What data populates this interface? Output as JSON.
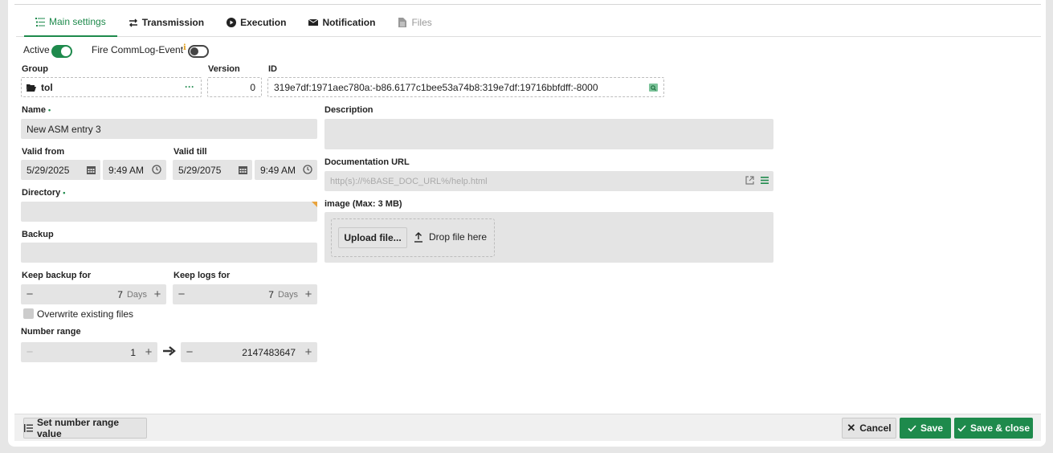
{
  "tabs": [
    {
      "label": "Main settings",
      "icon": "list-icon"
    },
    {
      "label": "Transmission",
      "icon": "arrows-swap-icon"
    },
    {
      "label": "Execution",
      "icon": "play-circle-icon"
    },
    {
      "label": "Notification",
      "icon": "envelope-icon"
    },
    {
      "label": "Files",
      "icon": "file-icon"
    }
  ],
  "active_tab": "Main settings",
  "toggles": {
    "active_label": "Active",
    "active_on": true,
    "fire_label": "Fire CommLog-Event",
    "fire_on": false
  },
  "group": {
    "label": "Group",
    "value": "tol",
    "more": "···"
  },
  "version": {
    "label": "Version",
    "value": "0"
  },
  "id": {
    "label": "ID",
    "value": "319e7df:1971aec780a:-b86.6177c1bee53a74b8:319e7df:19716bbfdff:-8000"
  },
  "name": {
    "label": "Name",
    "value": "New ASM entry 3",
    "required": "•"
  },
  "valid_from": {
    "label": "Valid from",
    "date": "5/29/2025",
    "time": "9:49 AM"
  },
  "valid_till": {
    "label": "Valid till",
    "date": "5/29/2075",
    "time": "9:49 AM"
  },
  "directory": {
    "label": "Directory",
    "value": "",
    "required": "•"
  },
  "backup": {
    "label": "Backup",
    "value": ""
  },
  "keep_backup": {
    "label": "Keep backup for",
    "value": "7",
    "unit": "Days"
  },
  "keep_logs": {
    "label": "Keep logs for",
    "value": "7",
    "unit": "Days"
  },
  "overwrite": {
    "label": "Overwrite existing files",
    "checked": false
  },
  "number_range": {
    "label": "Number range",
    "from": "1",
    "to": "2147483647"
  },
  "description": {
    "label": "Description",
    "value": ""
  },
  "doc_url": {
    "label": "Documentation URL",
    "placeholder": "http(s)://%BASE_DOC_URL%/help.html"
  },
  "image": {
    "label": "image (Max: 3 MB)",
    "upload_label": "Upload file...",
    "drop_label": "Drop file here"
  },
  "footer": {
    "set_range_label": "Set number range value",
    "cancel_label": "Cancel",
    "save_label": "Save",
    "save_close_label": "Save & close"
  },
  "colors": {
    "accent": "#1e8a4c",
    "field_bg": "#e4e4e4"
  }
}
